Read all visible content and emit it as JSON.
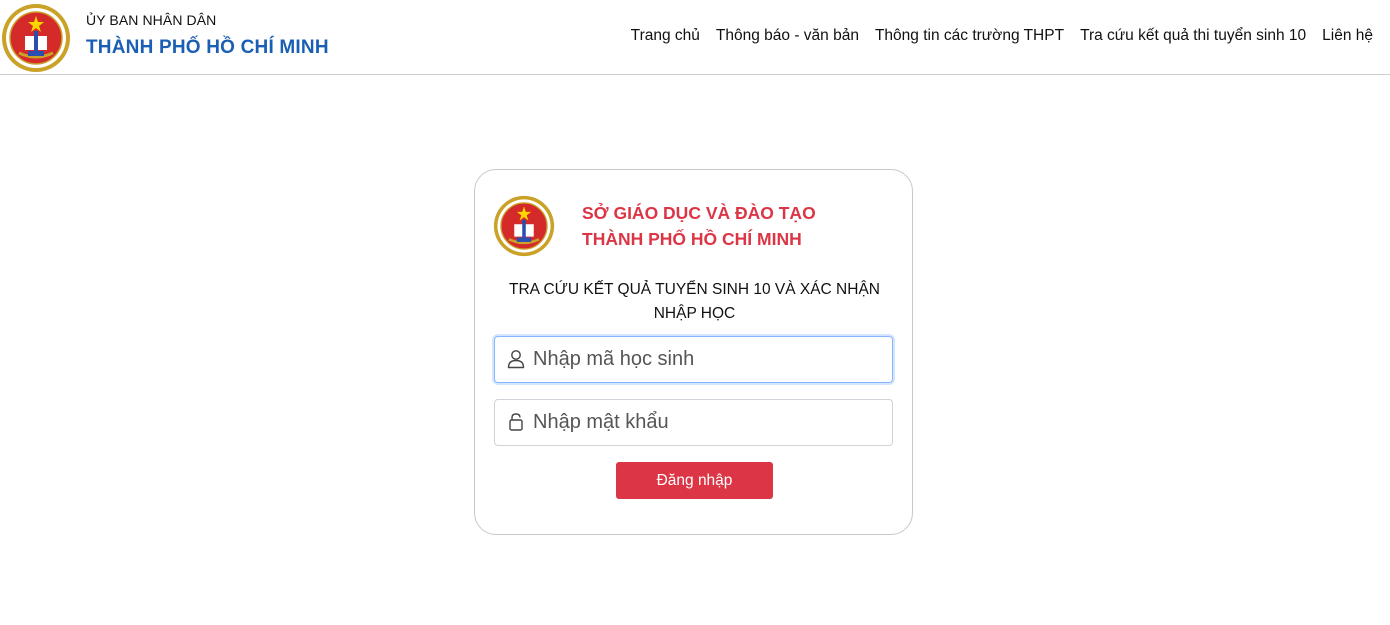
{
  "header": {
    "org_name": "ỦY BAN NHÂN DÂN",
    "city_name": "THÀNH PHỐ HỒ CHÍ MINH",
    "logo_icon": "education-emblem-icon"
  },
  "nav": {
    "items": [
      {
        "label": "Trang chủ"
      },
      {
        "label": "Thông báo - văn bản"
      },
      {
        "label": "Thông tin các trường THPT"
      },
      {
        "label": "Tra cứu kết quả thi tuyển sinh 10"
      },
      {
        "label": "Liên hệ"
      }
    ]
  },
  "login": {
    "dept_line1": "SỞ GIÁO DỤC VÀ ĐÀO TẠO",
    "dept_line2": "THÀNH PHỐ HỒ CHÍ MINH",
    "subtitle": "TRA CỨU KẾT QUẢ TUYỂN SINH 10 VÀ XÁC NHẬN NHẬP HỌC",
    "student_id_placeholder": "Nhập mã học sinh",
    "student_id_value": "",
    "password_placeholder": "Nhập mật khẩu",
    "password_value": "",
    "submit_label": "Đăng nhập"
  },
  "colors": {
    "brand_blue": "#1a5fb4",
    "accent_red": "#dc3545",
    "focus_border": "#86b7fe"
  }
}
